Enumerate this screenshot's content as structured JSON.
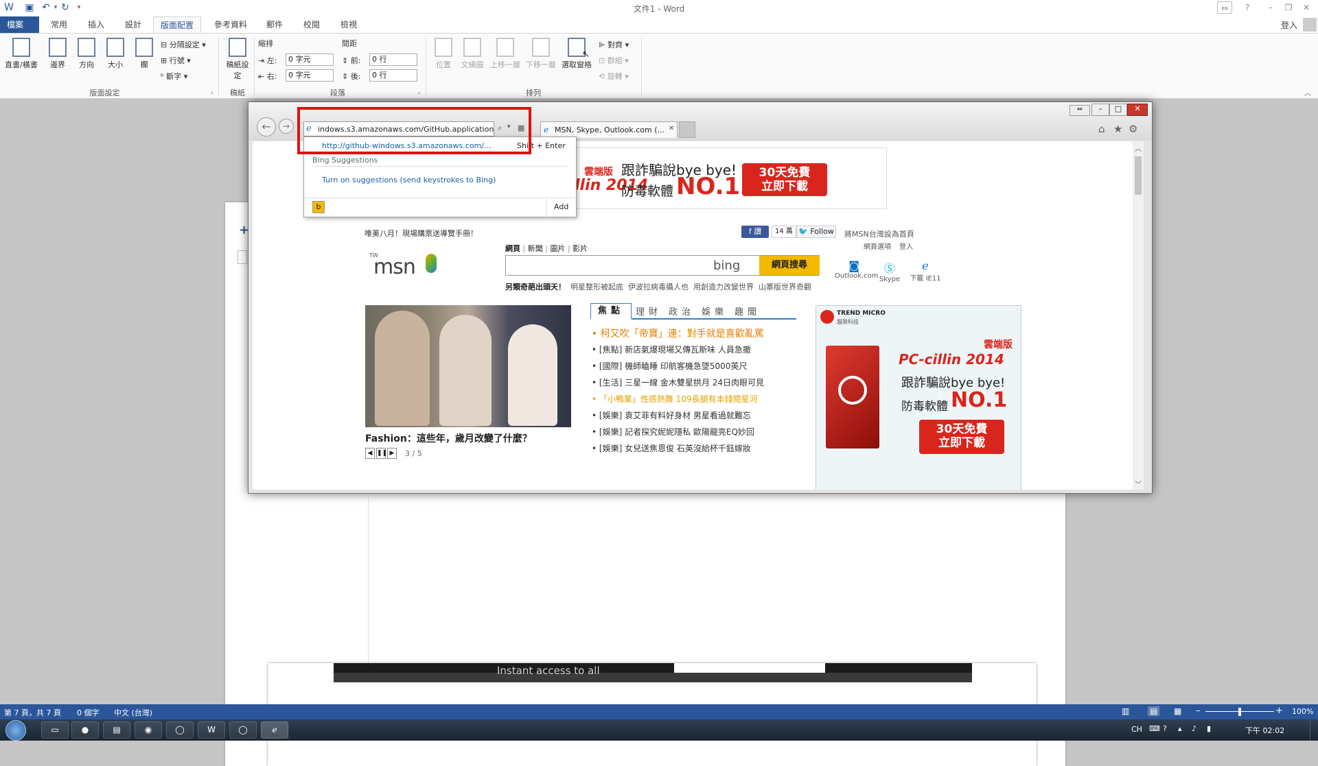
{
  "window_title": "文件1 - Word",
  "title_bar_right": {
    "signin": "登入"
  },
  "ribbon_tabs": [
    "檔案",
    "常用",
    "插入",
    "設計",
    "版面配置",
    "參考資料",
    "郵件",
    "校閱",
    "檢視"
  ],
  "ribbon": {
    "page_setup": {
      "text_direction": "直書/橫書",
      "margins": "邊界",
      "orientation": "方向",
      "size": "大小",
      "columns": "欄",
      "breaks": "分隔設定",
      "line_numbers": "行號",
      "hyphenation": "斷字",
      "group_label": "版面設定"
    },
    "manuscript": {
      "button": "稿紙設定",
      "group_label": "稿紙"
    },
    "paragraph": {
      "indent_label": "縮排",
      "spacing_label": "間距",
      "left_label": "左:",
      "right_label": "右:",
      "before_label": "前:",
      "after_label": "後:",
      "left_value": "0 字元",
      "right_value": "0 字元",
      "before_value": "0 行",
      "after_value": "0 行",
      "group_label": "段落"
    },
    "arrange": {
      "position": "位置",
      "wrap_text": "文繞圖",
      "bring_forward": "上移一層",
      "send_backward": "下移一層",
      "selection_pane": "選取窗格",
      "align": "對齊",
      "group": "群組",
      "rotate": "旋轉",
      "group_label": "排列"
    }
  },
  "browser": {
    "address": "indows.s3.amazonaws.com/GitHub.application",
    "tab_title": "MSN, Skype, Outlook.com (...",
    "dropdown": {
      "suggest_url": "http://github-windows.s3.amazonaws.com/...",
      "shortcut": "Shift + Enter",
      "section": "Bing Suggestions",
      "turn_on": "Turn on suggestions (send keystrokes to Bing)",
      "add": "Add"
    }
  },
  "msn": {
    "top_ad": {
      "edition": "雲端版",
      "product": "PC-cillin 2014",
      "line1": "跟詐騙說bye bye!",
      "line2": "防毒軟體",
      "rank": "NO.1",
      "promo1": "30天免費",
      "promo2": "立即下載"
    },
    "promo_text": "唯美八月！現場購票送導覽手冊！",
    "fb_like": "讚",
    "fb_count": "14 萬",
    "twitter": "Follow",
    "set_home": "將MSN台灣設為首頁",
    "options": "網頁選項",
    "login": "登入",
    "logo_tw": "TW",
    "logo": "msn",
    "search_tabs": [
      "網頁",
      "新聞",
      "圖片",
      "影片"
    ],
    "bing": "bing",
    "search_button": "網頁搜尋",
    "trending_title": "另類奇葩出頭天！",
    "trending": [
      "明星整形被起底",
      "伊波拉病毒攝人也",
      "用創造力改變世界",
      "山寨版世界奇觀"
    ],
    "services": [
      {
        "label": "Outlook.com",
        "icon": "outlook-icon"
      },
      {
        "label": "Skype",
        "icon": "skype-icon"
      },
      {
        "label": "下載 IE11",
        "icon": "ie-icon"
      }
    ],
    "feature_caption": "Fashion：這些年，歲月改變了什麼？",
    "slider_counter": "3 / 5",
    "news_tabs": [
      "焦點",
      "理財",
      "政治",
      "娛樂",
      "趣聞"
    ],
    "news": [
      {
        "text": "柯又吹「帝寶」連：對手就是喜歡亂罵",
        "hl": true
      },
      {
        "text": "[焦點] 新店氣爆現場又傳瓦斯味 人員急撤",
        "hl": false
      },
      {
        "text": "[國際] 機師瞌睡 印航客機急墜5000英尺",
        "hl": false
      },
      {
        "text": "[生活] 三星一線 金木雙星拱月 24日肉眼可見",
        "hl": false
      },
      {
        "text": "「小鴨業」性感熱舞 109長腿有本錢閱星河",
        "hl": "soft"
      },
      {
        "text": "[娛樂] 袁艾菲有料好身材 男星看過就難忘",
        "hl": false
      },
      {
        "text": "[娛樂] 記者探究妮妮隱私 歐陽龍亮EQ妙回",
        "hl": false
      },
      {
        "text": "[娛樂] 女兒送焦恩俊 石英沒給杯千鈺嫁妝",
        "hl": false
      }
    ],
    "side_ad": {
      "brand": "TREND MICRO",
      "brand_cn": "趨勢科技",
      "edition": "雲端版",
      "product": "PC-cillin 2014",
      "line1": "跟詐騙說bye bye!",
      "line2": "防毒軟體",
      "rank": "NO.1",
      "promo1": "30天免費",
      "promo2": "立即下載"
    }
  },
  "doc_embedded_caption": "Instant access to all",
  "status_bar": {
    "page": "第 7 頁，共 7 頁",
    "words": "0 個字",
    "lang": "中文 (台灣)",
    "zoom": "100%",
    "zoom_level": 1.0
  },
  "taskbar": {
    "ime": "CH",
    "time": "下午 02:02"
  }
}
